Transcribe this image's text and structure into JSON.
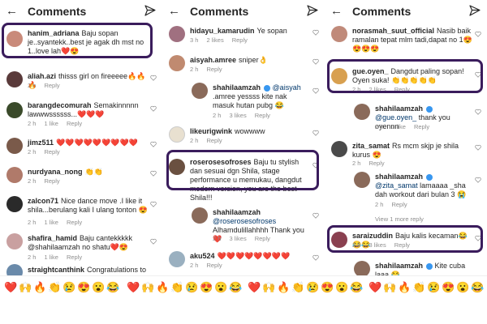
{
  "panels": [
    {
      "title": "Comments",
      "comments": [
        {
          "user": "hanim_adriana",
          "text": "Baju sopan je..syantekk..best je agak dh mst no 1..love lah❤️😍",
          "time": "",
          "likes": "",
          "reply": ""
        },
        {
          "user": "aliah.azi",
          "text": "thisss girl on fireeeee🔥🔥🔥",
          "time": "2 h",
          "likes": "",
          "reply": "Reply"
        },
        {
          "user": "barangdecomurah",
          "text": "Semakinnnnn lawwwssssss...❤️❤️❤️",
          "time": "2 h",
          "likes": "1 like",
          "reply": "Reply"
        },
        {
          "user": "jimz511",
          "text": "❤️❤️❤️❤️❤️❤️❤️❤️❤️",
          "time": "2 h",
          "likes": "",
          "reply": "Reply"
        },
        {
          "user": "nurdyana_nong",
          "text": "👏👏",
          "time": "2 h",
          "likes": "",
          "reply": "Reply"
        },
        {
          "user": "zalcon71",
          "text": "Nice dance move .I like it shila...berulang kali I ulang tonton 😍",
          "time": "2 h",
          "likes": "1 like",
          "reply": "Reply"
        },
        {
          "user": "shafira_hamid",
          "text": "Baju cantekkkkk @shahilaamzah no shatu❤️😍",
          "mention": "",
          "time": "2 h",
          "likes": "1 like",
          "reply": "Reply"
        },
        {
          "user": "straightcanthink",
          "text": "Congratulations to",
          "time": "",
          "likes": "",
          "reply": ""
        }
      ]
    },
    {
      "title": "Comments",
      "comments": [
        {
          "user": "hidayu_kamarudin",
          "text": "Ye sopan",
          "time": "3 h",
          "likes": "2 likes",
          "reply": "Reply"
        },
        {
          "user": "aisyah.amree",
          "text": "sniper👌",
          "time": "2 h",
          "likes": "",
          "reply": "Reply"
        },
        {
          "user": "shahilaamzah",
          "mention": "@aisyah",
          "text": ".amree yessss kite nak masuk hutan pubg 😂",
          "time": "2 h",
          "likes": "3 likes",
          "reply": "Reply"
        },
        {
          "user": "likeurigwink",
          "text": "wowwww",
          "time": "2 h",
          "likes": "",
          "reply": "Reply"
        },
        {
          "user": "roserosesofroses",
          "text": "Baju tu stylish dan sesuai dgn Shila, stage performance u memukau, dangdut modern version, you are the best Shila!!!",
          "time": "",
          "likes": "",
          "reply": ""
        },
        {
          "user": "shahilaamzah",
          "mention": "@roserosesofroses",
          "text": "Alhamdulillahhhh Thank you ❤️",
          "time": "2 h",
          "likes": "3 likes",
          "reply": "Reply"
        },
        {
          "user": "aku524",
          "text": "❤️❤️❤️❤️❤️❤️❤️❤️",
          "time": "2 h",
          "likes": "",
          "reply": "Reply"
        }
      ]
    },
    {
      "title": "Comments",
      "comments": [
        {
          "user": "norasmah_suut_official",
          "text": "Nasib baik ramalan tepat mlm tadi,dapat no 1😍😍😍😍",
          "time": "",
          "likes": "",
          "reply": ""
        },
        {
          "user": "gue.oyen_",
          "text": "Dangdut paling sopan! Oyen suka! 👏👏👏👏👏",
          "time": "2 h",
          "likes": "2 likes",
          "reply": "Reply"
        },
        {
          "user": "shahilaamzah",
          "mention": "@gue.oyen_",
          "text": "thank you oyennn",
          "time": "2 h",
          "likes": "1 like",
          "reply": "Reply"
        },
        {
          "user": "zita_samat",
          "text": "Rs mcm skjp je shila kurus 😍",
          "time": "2 h",
          "likes": "",
          "reply": "Reply"
        },
        {
          "user": "shahilaamzah",
          "mention": "@zita_samat",
          "text": "lamaaaa _sha dah workout dari bulan 3 😭",
          "time": "2 h",
          "likes": "",
          "reply": "Reply"
        },
        {
          "user": "saraizuddin",
          "text": "Baju kalis kecaman😂😂😂",
          "time": "2 h",
          "likes": "3 likes",
          "reply": "Reply"
        },
        {
          "user": "shahilaamzah",
          "text": "Kite cuba laaa 😂",
          "time": "",
          "likes": "",
          "reply": ""
        }
      ],
      "view_replies": "View 1 more reply"
    }
  ],
  "emoji_bar": [
    "❤️",
    "🙌",
    "🔥",
    "👏",
    "😢",
    "😍",
    "😮",
    "😂",
    "❤️",
    "🙌",
    "🔥",
    "👏",
    "😢",
    "😍",
    "😮",
    "😂",
    "❤️",
    "🙌",
    "🔥",
    "👏",
    "😢",
    "😍",
    "😮",
    "😂",
    "❤️",
    "🙌",
    "🔥",
    "👏",
    "😢",
    "😍",
    "😮",
    "😂"
  ],
  "watermark": "ov•ol",
  "icons": {
    "back": "back-arrow-icon",
    "send": "direct-send-icon",
    "like": "heart-icon"
  },
  "colors": {
    "highlight": "#3a1c5c",
    "meta": "#8e8e8e",
    "mention": "#00376b",
    "verified": "#3897f0"
  }
}
